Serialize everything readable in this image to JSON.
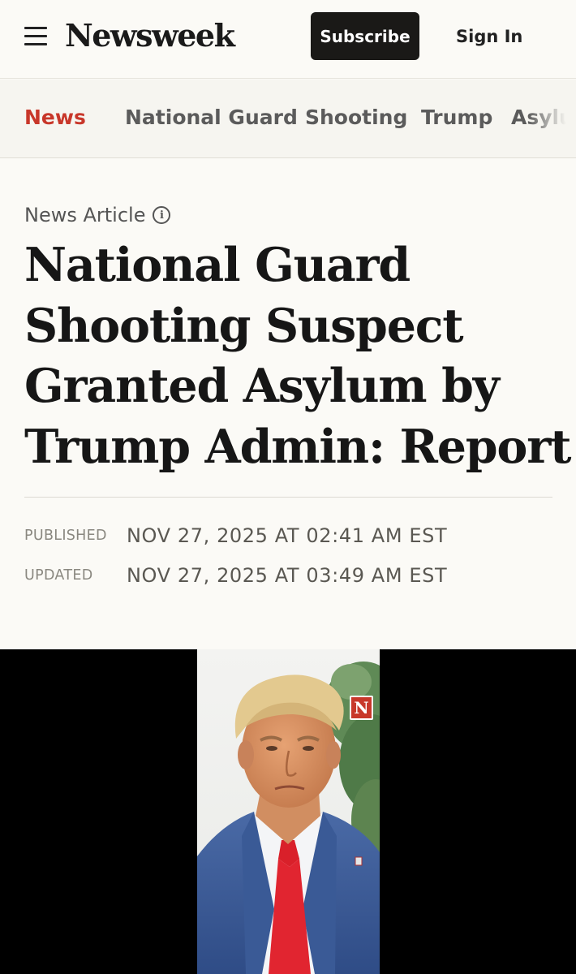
{
  "header": {
    "logo": "Newsweek",
    "subscribe_label": "Subscribe",
    "signin_label": "Sign In"
  },
  "nav": {
    "items": [
      {
        "label": "News",
        "active": true
      },
      {
        "label": "National Guard"
      },
      {
        "label": "Shooting"
      },
      {
        "label": "Trump"
      },
      {
        "label": "Asylum"
      }
    ]
  },
  "article": {
    "type_label": "News Article",
    "headline_lines": [
      "National Guard",
      "Shooting Suspect",
      "Granted Asylum by",
      "Trump Admin: Report"
    ],
    "published_label": "PUBLISHED",
    "published_value": "NOV 27, 2025 AT 02:41 AM EST",
    "updated_label": "UPDATED",
    "updated_value": "NOV 27, 2025 AT 03:49 AM EST"
  },
  "media": {
    "badge_letter": "N"
  },
  "colors": {
    "accent": "#c8372a",
    "background": "#fbfaf6",
    "subscribe_bg": "#1a1917"
  }
}
